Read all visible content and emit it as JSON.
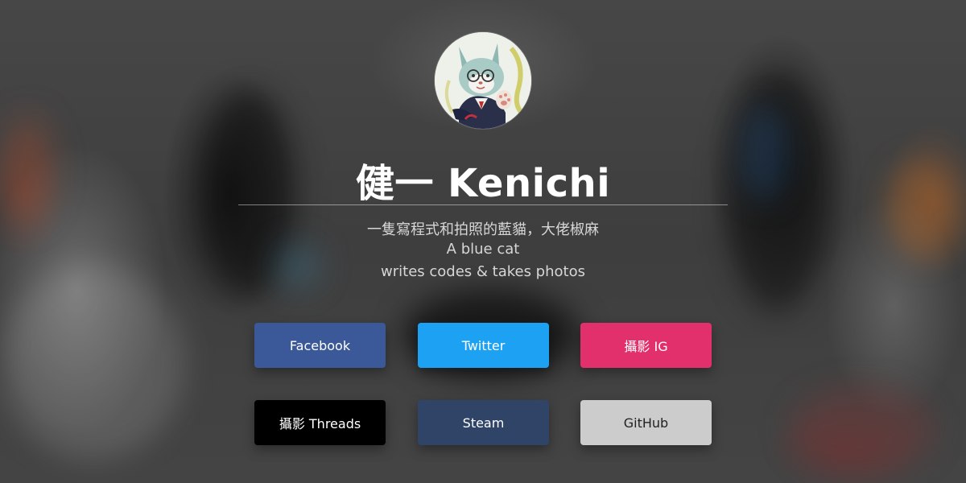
{
  "profile": {
    "name": "健一 Kenichi",
    "tagline_zh": "一隻寫程式和拍照的藍貓，大佬椒麻",
    "tagline_en_line1": "A blue cat",
    "tagline_en_line2": "writes codes & takes photos"
  },
  "links": [
    {
      "label": "Facebook",
      "color": "#3b5998",
      "text_color": "#ffffff"
    },
    {
      "label": "Twitter",
      "color": "#1da1f2",
      "text_color": "#ffffff"
    },
    {
      "label": "攝影 IG",
      "color": "#e1306c",
      "text_color": "#ffffff"
    },
    {
      "label": "攝影 Threads",
      "color": "#000000",
      "text_color": "#ffffff"
    },
    {
      "label": "Steam",
      "color": "#2f4466",
      "text_color": "#ffffff"
    },
    {
      "label": "GitHub",
      "color": "#cccccc",
      "text_color": "#222222"
    }
  ]
}
